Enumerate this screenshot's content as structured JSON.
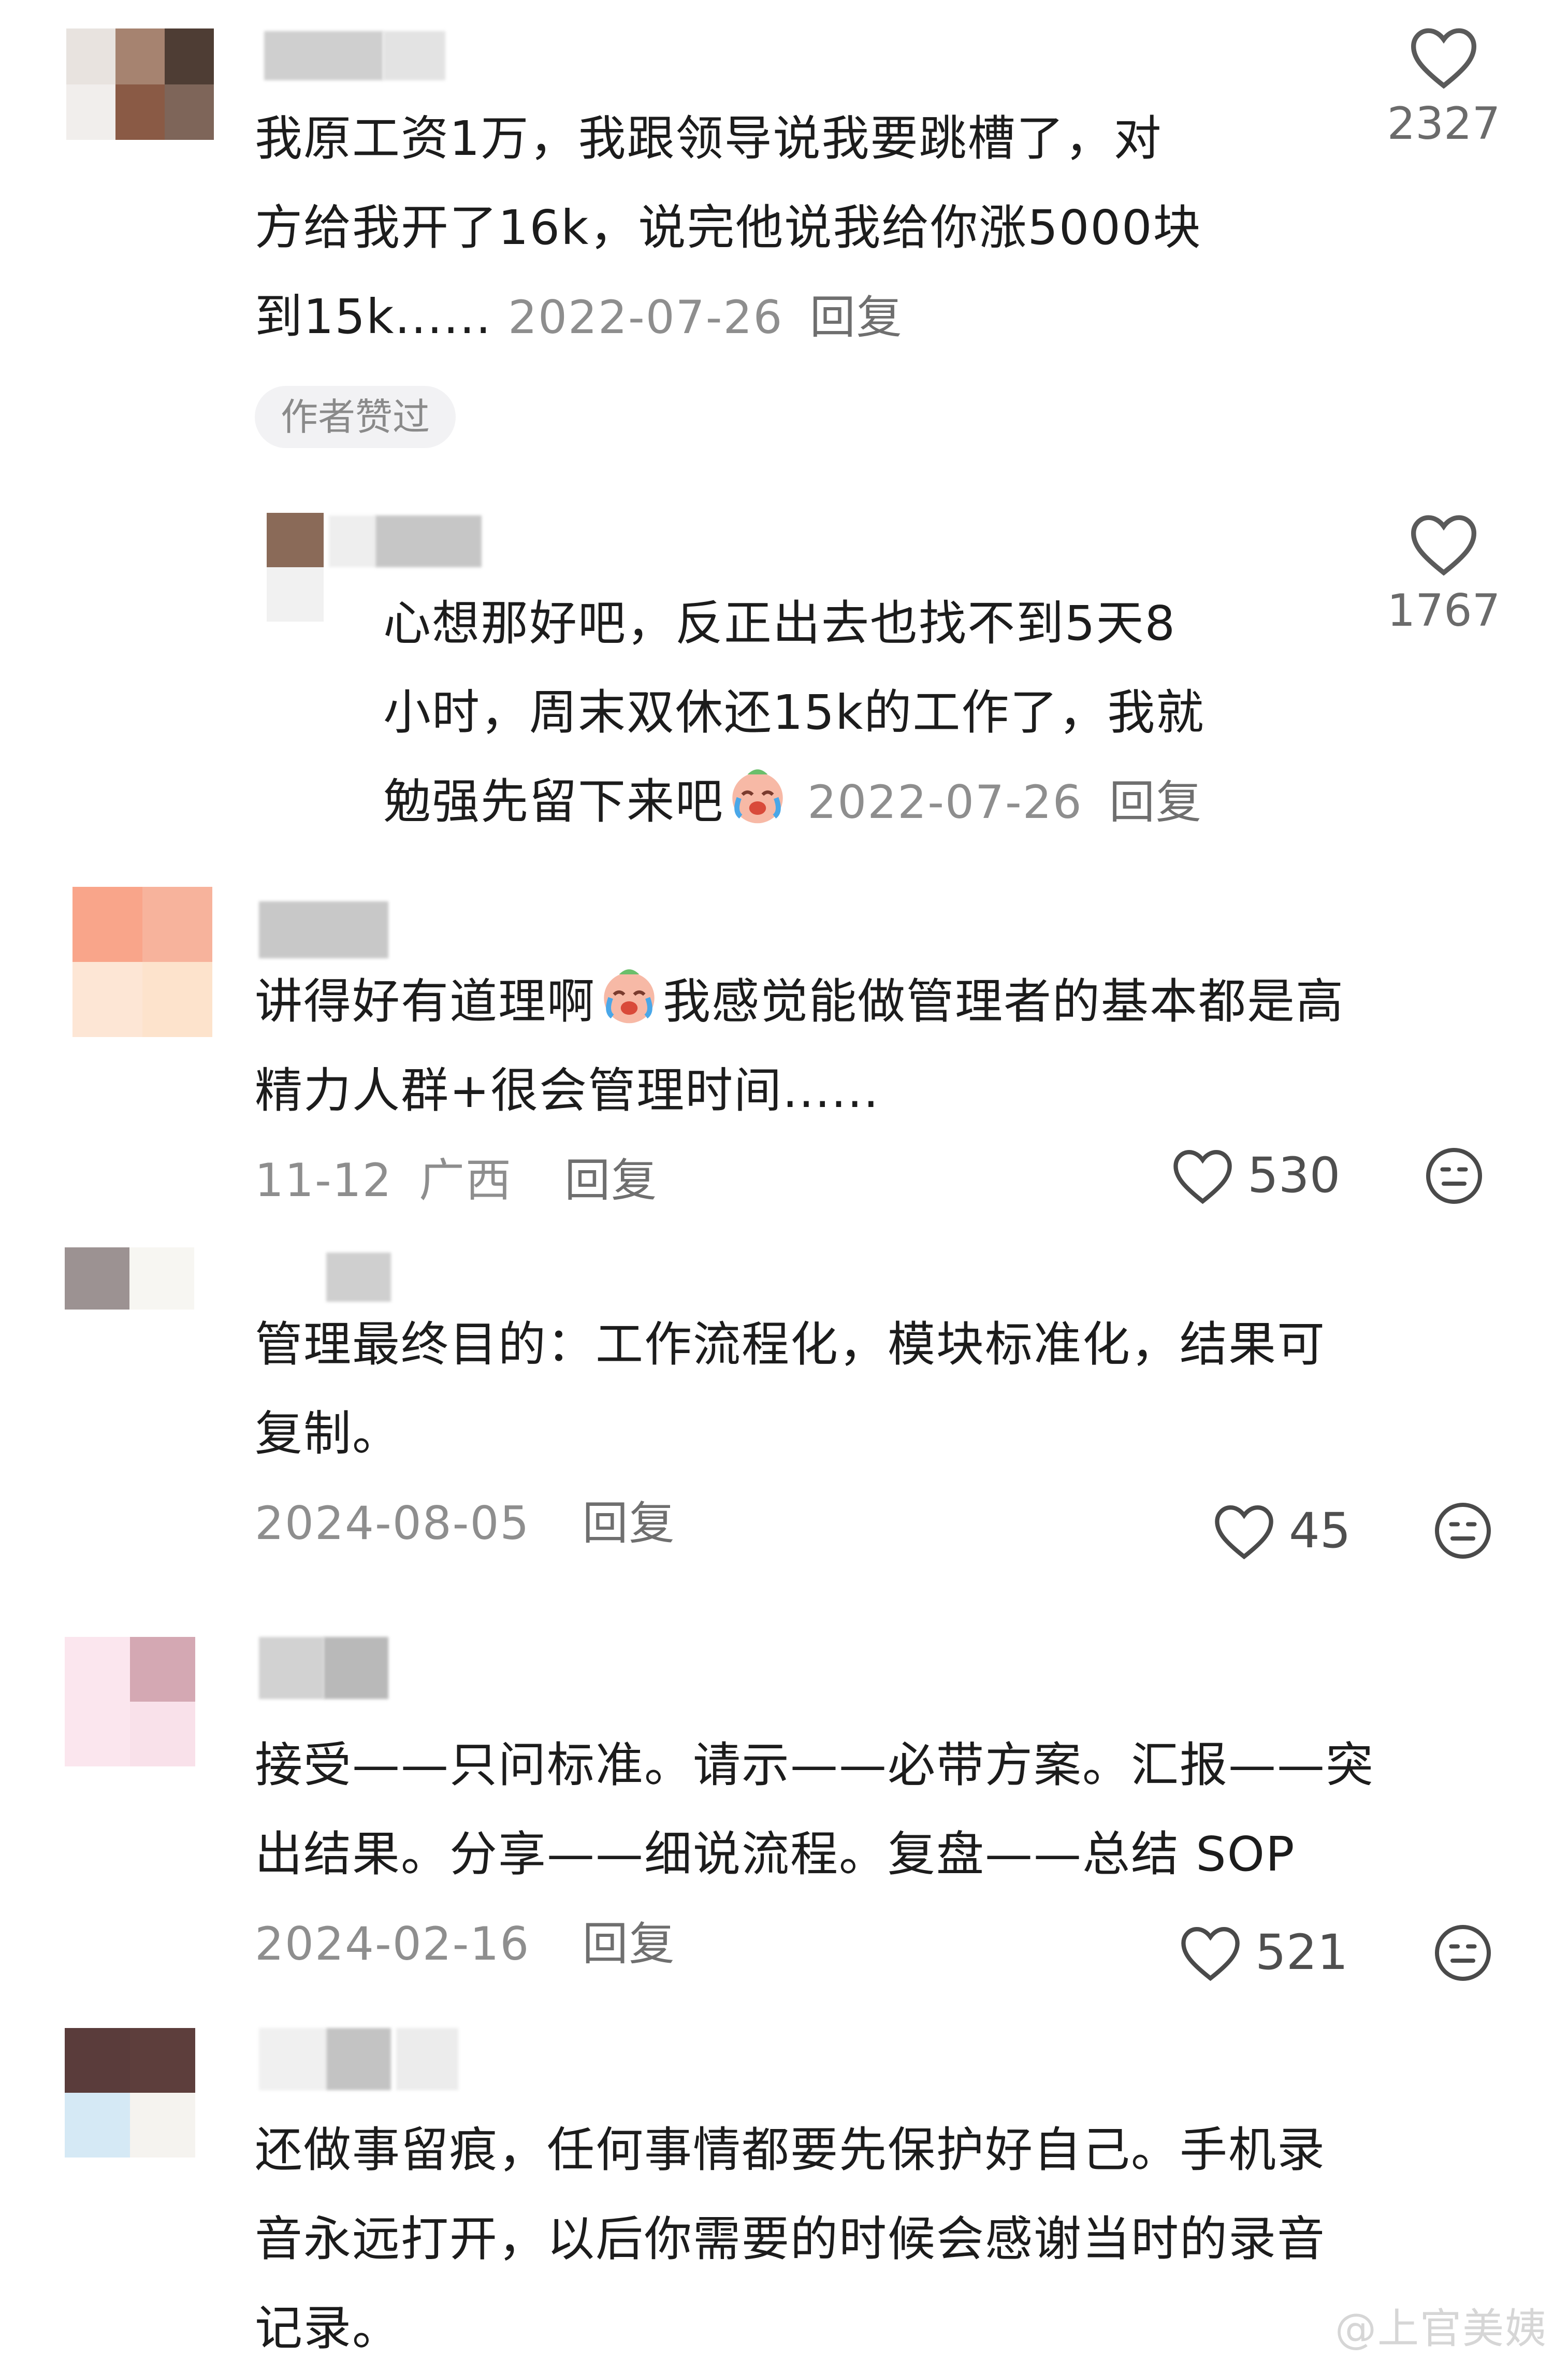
{
  "comments": [
    {
      "text_lines": [
        "我原工资1万，我跟领导说我要跳槽了，对",
        "方给我开了16k，说完他说我给你涨5000块",
        "到15k......"
      ],
      "date": "2022-07-26",
      "reply_label": "回复",
      "tag": "作者赞过",
      "like_count": "2327"
    },
    {
      "text_lines": [
        "心想那好吧，反正出去也找不到5天8",
        "小时，周末双休还15k的工作了，我就",
        "勉强先留下来吧"
      ],
      "date": "2022-07-26",
      "reply_label": "回复",
      "like_count": "1767"
    },
    {
      "text_lines": [
        "讲得好有道理啊",
        "我感觉能做管理者的基本都是高",
        "精力人群+很会管理时间......"
      ],
      "date": "11-12",
      "location": "广西",
      "reply_label": "回复",
      "like_count": "530"
    },
    {
      "text_lines": [
        "管理最终目的：工作流程化，模块标准化，结果可",
        "复制。"
      ],
      "date": "2024-08-05",
      "reply_label": "回复",
      "like_count": "45"
    },
    {
      "text_lines": [
        "接受——只问标准。请示——必带方案。汇报——突",
        "出结果。分享——细说流程。复盘——总结 SOP"
      ],
      "date": "2024-02-16",
      "reply_label": "回复",
      "like_count": "521"
    },
    {
      "text_lines": [
        "还做事留痕，任何事情都要先保护好自己。手机录",
        "音永远打开，以后你需要的时候会感谢当时的录音",
        "记录。"
      ]
    }
  ],
  "watermark": "@上官美姨",
  "icons": {
    "like": "heart-outline-icon",
    "dislike": "neutral-face-icon",
    "emoji": "crying-laughing-emoji-icon"
  },
  "colors": {
    "meta_gray": "#8e8e8e",
    "icon_gray": "#4f4f4f",
    "tag_bg": "#f2f2f4"
  }
}
